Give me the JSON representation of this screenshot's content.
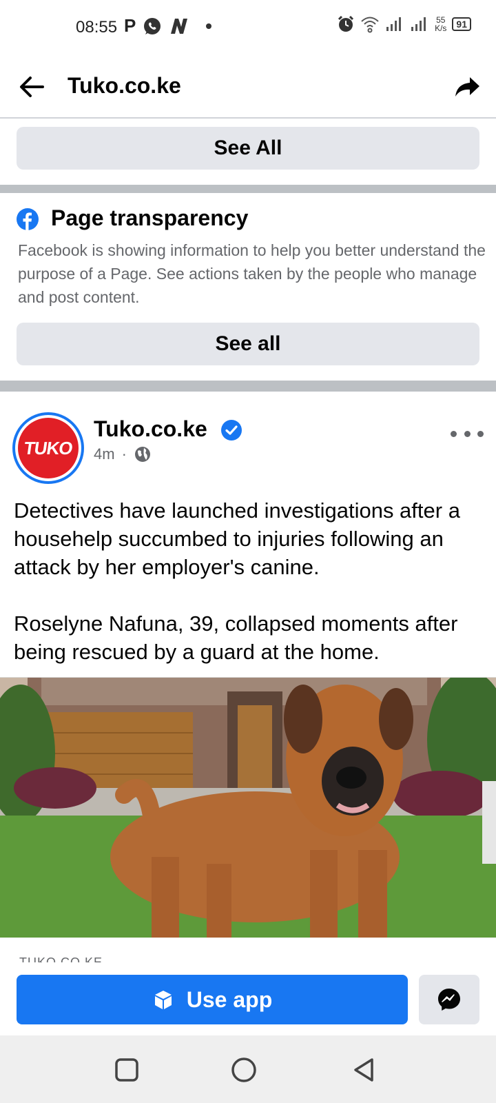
{
  "status_bar": {
    "time": "08:55",
    "left_icons": [
      "p-app-icon",
      "whatsapp-icon",
      "n-app-icon",
      "dot-icon"
    ],
    "speed_value": "55",
    "speed_unit": "K/s",
    "battery": "91"
  },
  "header": {
    "title": "Tuko.co.ke"
  },
  "sections": {
    "see_all_top": "See All",
    "transparency_title": "Page transparency",
    "transparency_desc": "Facebook is showing information to help you better understand the purpose of a Page. See actions taken by the people who manage and post content.",
    "see_all_bottom": "See all"
  },
  "post": {
    "avatar_text": "TUKO",
    "author": "Tuko.co.ke",
    "time": "4m",
    "paragraph_1": "Detectives have launched investigations after a househelp succumbed to injuries following an attack by her employer's canine.",
    "paragraph_2": "Roselyne Nafuna, 39, collapsed moments after being rescued by a guard at the home.",
    "link_source": "TUKO.CO.KE"
  },
  "bottom": {
    "use_app": "Use app"
  },
  "colors": {
    "fb_blue": "#1877f2",
    "button_gray": "#e4e6eb",
    "divider": "#bcc0c4",
    "secondary_text": "#65676b",
    "tuko_red": "#e11f26"
  }
}
